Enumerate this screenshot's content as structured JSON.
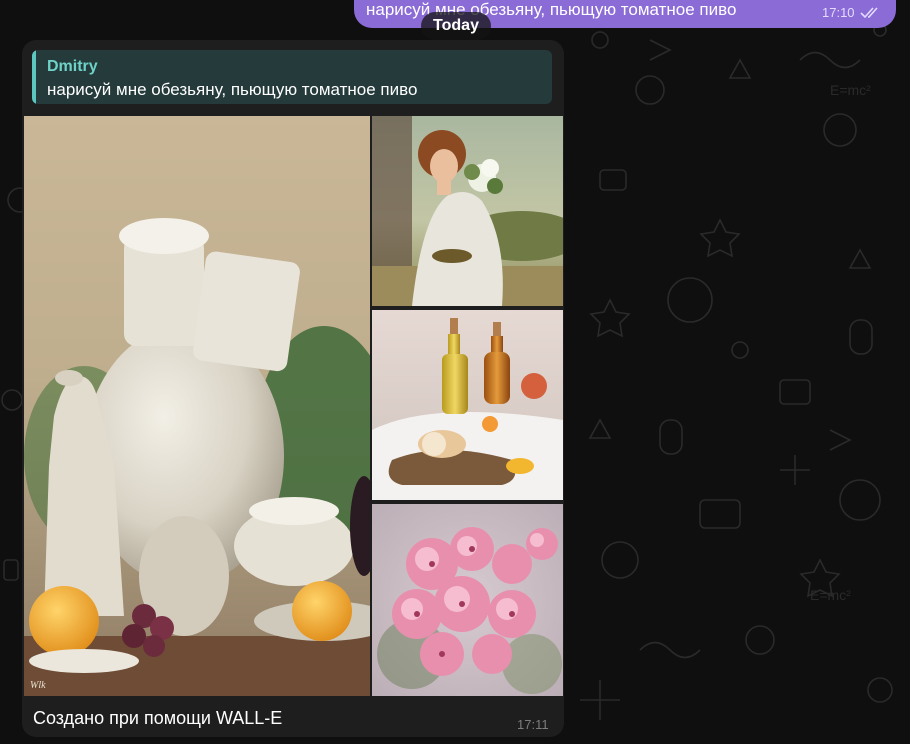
{
  "outgoing_message": {
    "text": "нарисуй мне обезьяну, пьющую томатное пиво",
    "time": "17:10",
    "status_icon": "double-check-icon"
  },
  "date_separator": "Today",
  "incoming_message": {
    "reply": {
      "author": "Dmitry",
      "text": "нарисуй мне обезьяну, пьющую томатное пиво"
    },
    "caption": "Создано при помощи WALL-E",
    "time": "17:11",
    "photos": [
      "still-life-jugs-image",
      "woman-with-flowers-image",
      "oil-bottles-image",
      "pink-flowers-image"
    ]
  },
  "colors": {
    "background": "#0f0f0f",
    "outgoing_bubble": "#8b6bd6",
    "incoming_bubble": "#1e1e1e",
    "reply_accent": "#5cc7c0",
    "reply_author": "#6fd2c8"
  }
}
